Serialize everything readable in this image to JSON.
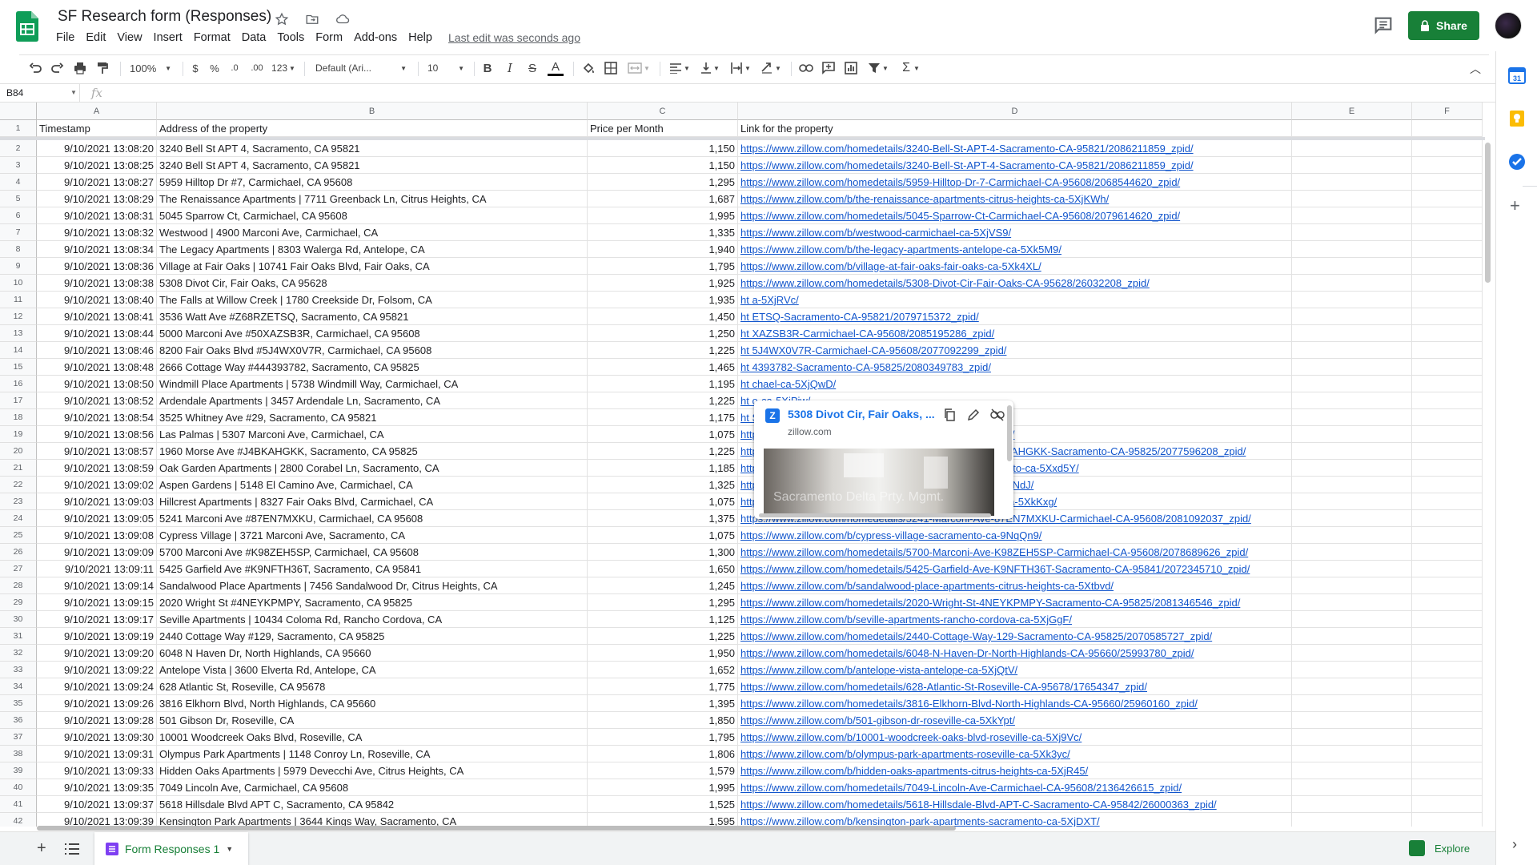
{
  "header": {
    "title": "SF Research form (Responses)",
    "menu": [
      "File",
      "Edit",
      "View",
      "Insert",
      "Format",
      "Data",
      "Tools",
      "Form",
      "Add-ons",
      "Help"
    ],
    "last_edit": "Last edit was seconds ago",
    "share_label": "Share"
  },
  "toolbar": {
    "zoom": "100%",
    "currency": "$",
    "percent": "%",
    "decrease_decimal": ".0",
    "increase_decimal": ".00",
    "number_format": "123",
    "font": "Default (Ari...",
    "font_size": "10",
    "bold": "B",
    "italic": "I",
    "strike": "S",
    "text_color": "A",
    "function": "Σ"
  },
  "formula_bar": {
    "name_box": "B84",
    "fx": "fx"
  },
  "columns": [
    "A",
    "B",
    "C",
    "D",
    "E",
    "F"
  ],
  "headers": [
    "Timestamp",
    "Address of the property",
    "Price per Month",
    "Link for the property"
  ],
  "rows": [
    [
      "9/10/2021 13:08:20",
      "3240 Bell St APT 4, Sacramento, CA 95821",
      "1,150",
      "https://www.zillow.com/homedetails/3240-Bell-St-APT-4-Sacramento-CA-95821/2086211859_zpid/"
    ],
    [
      "9/10/2021 13:08:25",
      "3240 Bell St APT 4, Sacramento, CA 95821",
      "1,150",
      "https://www.zillow.com/homedetails/3240-Bell-St-APT-4-Sacramento-CA-95821/2086211859_zpid/"
    ],
    [
      "9/10/2021 13:08:27",
      "5959 Hilltop Dr #7, Carmichael, CA 95608",
      "1,295",
      "https://www.zillow.com/homedetails/5959-Hilltop-Dr-7-Carmichael-CA-95608/2068544620_zpid/"
    ],
    [
      "9/10/2021 13:08:29",
      "The Renaissance Apartments | 7711 Greenback Ln, Citrus Heights, CA",
      "1,687",
      "https://www.zillow.com/b/the-renaissance-apartments-citrus-heights-ca-5XjKWh/"
    ],
    [
      "9/10/2021 13:08:31",
      "5045 Sparrow Ct, Carmichael, CA 95608",
      "1,995",
      "https://www.zillow.com/homedetails/5045-Sparrow-Ct-Carmichael-CA-95608/2079614620_zpid/"
    ],
    [
      "9/10/2021 13:08:32",
      "Westwood | 4900 Marconi Ave, Carmichael, CA",
      "1,335",
      "https://www.zillow.com/b/westwood-carmichael-ca-5XjVS9/"
    ],
    [
      "9/10/2021 13:08:34",
      "The Legacy Apartments | 8303 Walerga Rd, Antelope, CA",
      "1,940",
      "https://www.zillow.com/b/the-legacy-apartments-antelope-ca-5Xk5M9/"
    ],
    [
      "9/10/2021 13:08:36",
      "Village at Fair Oaks | 10741 Fair Oaks Blvd, Fair Oaks, CA",
      "1,795",
      "https://www.zillow.com/b/village-at-fair-oaks-fair-oaks-ca-5Xk4XL/"
    ],
    [
      "9/10/2021 13:08:38",
      "5308 Divot Cir, Fair Oaks, CA 95628",
      "1,925",
      "https://www.zillow.com/homedetails/5308-Divot-Cir-Fair-Oaks-CA-95628/26032208_zpid/"
    ],
    [
      "9/10/2021 13:08:40",
      "The Falls at Willow Creek | 1780 Creekside Dr, Folsom, CA",
      "1,935",
      "ht                                                                         a-5XjRVc/"
    ],
    [
      "9/10/2021 13:08:41",
      "3536 Watt Ave #Z68RZETSQ, Sacramento, CA 95821",
      "1,450",
      "ht                                                                         ETSQ-Sacramento-CA-95821/2079715372_zpid/"
    ],
    [
      "9/10/2021 13:08:44",
      "5000 Marconi Ave #50XAZSB3R, Carmichael, CA 95608",
      "1,250",
      "ht                                                                         XAZSB3R-Carmichael-CA-95608/2085195286_zpid/"
    ],
    [
      "9/10/2021 13:08:46",
      "8200 Fair Oaks Blvd #5J4WX0V7R, Carmichael, CA 95608",
      "1,225",
      "ht                                                                         5J4WX0V7R-Carmichael-CA-95608/2077092299_zpid/"
    ],
    [
      "9/10/2021 13:08:48",
      "2666 Cottage Way #444393782, Sacramento, CA 95825",
      "1,465",
      "ht                                                                         4393782-Sacramento-CA-95825/2080349783_zpid/"
    ],
    [
      "9/10/2021 13:08:50",
      "Windmill Place Apartments | 5738 Windmill Way, Carmichael, CA",
      "1,195",
      "ht                                                                         chael-ca-5XjQwD/"
    ],
    [
      "9/10/2021 13:08:52",
      "Ardendale Apartments | 3457 Ardendale Ln, Sacramento, CA",
      "1,225",
      "ht                                                                         o-ca-5XjPjw/"
    ],
    [
      "9/10/2021 13:08:54",
      "3525 Whitney Ave #29, Sacramento, CA 95821",
      "1,175",
      "ht                                                                         Sacramento-CA-95821/2076961475_zpid/"
    ],
    [
      "9/10/2021 13:08:56",
      "Las Palmas | 5307 Marconi Ave, Carmichael, CA",
      "1,075",
      "https://www.zillow.com/b/las-palmas-carmichael-ca-5XjR77/"
    ],
    [
      "9/10/2021 13:08:57",
      "1960 Morse Ave #J4BKAHGKK, Sacramento, CA 95825",
      "1,225",
      "https://www.zillow.com/homedetails/1960-Morse-Ave-J4BKAHGKK-Sacramento-CA-95825/2077596208_zpid/"
    ],
    [
      "9/10/2021 13:08:59",
      "Oak Garden Apartments | 2800 Corabel Ln, Sacramento, CA",
      "1,185",
      "https://www.zillow.com/b/oak-garden-apartments-sacramento-ca-5Xxd5Y/"
    ],
    [
      "9/10/2021 13:09:02",
      "Aspen Gardens | 5148 El Camino Ave, Carmichael, CA",
      "1,325",
      "https://www.zillow.com/b/aspen-gardens-carmichael-ca-5XtNdJ/"
    ],
    [
      "9/10/2021 13:09:03",
      "Hillcrest Apartments | 8327 Fair Oaks Blvd, Carmichael, CA",
      "1,075",
      "https://www.zillow.com/b/hillcrest-apartments-carmichael-ca-5XkKxg/"
    ],
    [
      "9/10/2021 13:09:05",
      "5241 Marconi Ave #87EN7MXKU, Carmichael, CA 95608",
      "1,375",
      "https://www.zillow.com/homedetails/5241-Marconi-Ave-87EN7MXKU-Carmichael-CA-95608/2081092037_zpid/"
    ],
    [
      "9/10/2021 13:09:08",
      "Cypress Village | 3721 Marconi Ave, Sacramento, CA",
      "1,075",
      "https://www.zillow.com/b/cypress-village-sacramento-ca-9NqQn9/"
    ],
    [
      "9/10/2021 13:09:09",
      "5700 Marconi Ave #K98ZEH5SP, Carmichael, CA 95608",
      "1,300",
      "https://www.zillow.com/homedetails/5700-Marconi-Ave-K98ZEH5SP-Carmichael-CA-95608/2078689626_zpid/"
    ],
    [
      "9/10/2021 13:09:11",
      "5425 Garfield Ave #K9NFTH36T, Sacramento, CA 95841",
      "1,650",
      "https://www.zillow.com/homedetails/5425-Garfield-Ave-K9NFTH36T-Sacramento-CA-95841/2072345710_zpid/"
    ],
    [
      "9/10/2021 13:09:14",
      "Sandalwood Place Apartments | 7456 Sandalwood Dr, Citrus Heights, CA",
      "1,245",
      "https://www.zillow.com/b/sandalwood-place-apartments-citrus-heights-ca-5Xtbvd/"
    ],
    [
      "9/10/2021 13:09:15",
      "2020 Wright St #4NEYKPMPY, Sacramento, CA 95825",
      "1,295",
      "https://www.zillow.com/homedetails/2020-Wright-St-4NEYKPMPY-Sacramento-CA-95825/2081346546_zpid/"
    ],
    [
      "9/10/2021 13:09:17",
      "Seville Apartments | 10434 Coloma Rd, Rancho Cordova, CA",
      "1,125",
      "https://www.zillow.com/b/seville-apartments-rancho-cordova-ca-5XjGgF/"
    ],
    [
      "9/10/2021 13:09:19",
      "2440 Cottage Way #129, Sacramento, CA 95825",
      "1,225",
      "https://www.zillow.com/homedetails/2440-Cottage-Way-129-Sacramento-CA-95825/2070585727_zpid/"
    ],
    [
      "9/10/2021 13:09:20",
      "6048 N Haven Dr, North Highlands, CA 95660",
      "1,950",
      "https://www.zillow.com/homedetails/6048-N-Haven-Dr-North-Highlands-CA-95660/25993780_zpid/"
    ],
    [
      "9/10/2021 13:09:22",
      "Antelope Vista | 3600 Elverta Rd, Antelope, CA",
      "1,652",
      "https://www.zillow.com/b/antelope-vista-antelope-ca-5XjQtV/"
    ],
    [
      "9/10/2021 13:09:24",
      "628 Atlantic St, Roseville, CA 95678",
      "1,775",
      "https://www.zillow.com/homedetails/628-Atlantic-St-Roseville-CA-95678/17654347_zpid/"
    ],
    [
      "9/10/2021 13:09:26",
      "3816 Elkhorn Blvd, North Highlands, CA 95660",
      "1,395",
      "https://www.zillow.com/homedetails/3816-Elkhorn-Blvd-North-Highlands-CA-95660/25960160_zpid/"
    ],
    [
      "9/10/2021 13:09:28",
      "501 Gibson Dr, Roseville, CA",
      "1,850",
      "https://www.zillow.com/b/501-gibson-dr-roseville-ca-5XkYpt/"
    ],
    [
      "9/10/2021 13:09:30",
      "10001 Woodcreek Oaks Blvd, Roseville, CA",
      "1,795",
      "https://www.zillow.com/b/10001-woodcreek-oaks-blvd-roseville-ca-5Xj9Vc/"
    ],
    [
      "9/10/2021 13:09:31",
      "Olympus Park Apartments | 1148 Conroy Ln, Roseville, CA",
      "1,806",
      "https://www.zillow.com/b/olympus-park-apartments-roseville-ca-5Xk3yc/"
    ],
    [
      "9/10/2021 13:09:33",
      "Hidden Oaks Apartments | 5979 Devecchi Ave, Citrus Heights, CA",
      "1,579",
      "https://www.zillow.com/b/hidden-oaks-apartments-citrus-heights-ca-5XjR45/"
    ],
    [
      "9/10/2021 13:09:35",
      "7049 Lincoln Ave, Carmichael, CA 95608",
      "1,995",
      "https://www.zillow.com/homedetails/7049-Lincoln-Ave-Carmichael-CA-95608/2136426615_zpid/"
    ],
    [
      "9/10/2021 13:09:37",
      "5618 Hillsdale Blvd APT C, Sacramento, CA 95842",
      "1,525",
      "https://www.zillow.com/homedetails/5618-Hillsdale-Blvd-APT-C-Sacramento-CA-95842/26000363_zpid/"
    ],
    [
      "9/10/2021 13:09:39",
      "Kensington Park Apartments | 3644 Kings Way, Sacramento, CA",
      "1,595",
      "https://www.zillow.com/b/kensington-park-apartments-sacramento-ca-5XjDXT/"
    ]
  ],
  "link_preview": {
    "title": "5308 Divot Cir, Fair Oaks, ...",
    "domain": "zillow.com",
    "watermark": "Sacramento Delta Prty. Mgmt."
  },
  "bottom": {
    "sheet_tab": "Form Responses 1",
    "explore": "Explore"
  },
  "colors": {
    "brand_green": "#188038",
    "link_blue": "#1155cc"
  }
}
